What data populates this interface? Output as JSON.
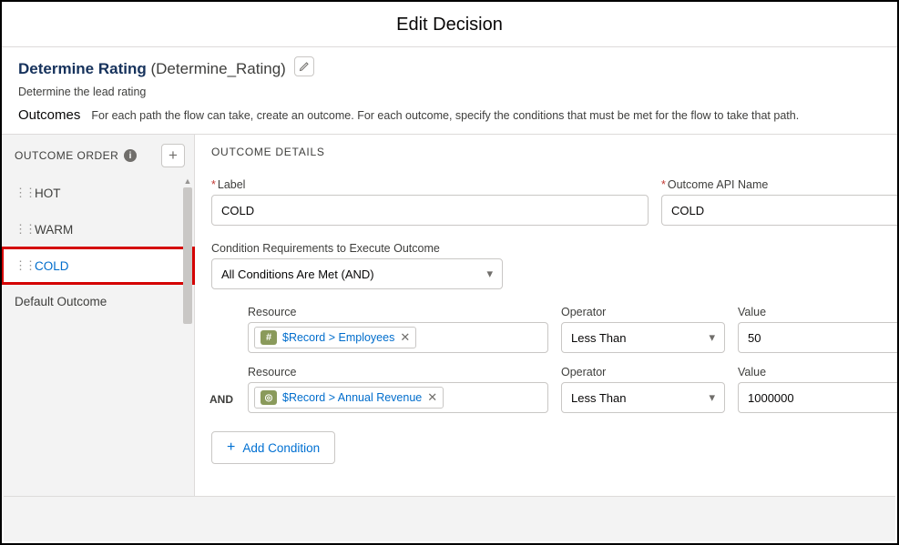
{
  "modal": {
    "title": "Edit Decision"
  },
  "decision": {
    "label": "Determine Rating",
    "apiName": "Determine_Rating",
    "description": "Determine the lead rating"
  },
  "outcomesSection": {
    "heading": "Outcomes",
    "instruction": "For each path the flow can take, create an outcome. For each outcome, specify the conditions that must be met for the flow to take that path."
  },
  "sidebar": {
    "heading": "OUTCOME ORDER",
    "addAria": "Add Outcome",
    "items": [
      {
        "label": "HOT",
        "selected": false
      },
      {
        "label": "WARM",
        "selected": false
      },
      {
        "label": "COLD",
        "selected": true
      }
    ],
    "defaultLabel": "Default Outcome"
  },
  "details": {
    "heading": "OUTCOME DETAILS",
    "labelField": {
      "label": "Label",
      "value": "COLD"
    },
    "apiField": {
      "label": "Outcome API Name",
      "value": "COLD"
    },
    "conditionReqLabel": "Condition Requirements to Execute Outcome",
    "conditionReqValue": "All Conditions Are Met (AND)",
    "columns": {
      "resource": "Resource",
      "operator": "Operator",
      "value": "Value"
    },
    "andLabel": "AND",
    "conditions": [
      {
        "iconType": "hash",
        "resource": "$Record > Employees",
        "operator": "Less Than",
        "value": "50"
      },
      {
        "iconType": "currency",
        "resource": "$Record > Annual Revenue",
        "operator": "Less Than",
        "value": "1000000"
      }
    ],
    "addCondition": "Add Condition"
  }
}
